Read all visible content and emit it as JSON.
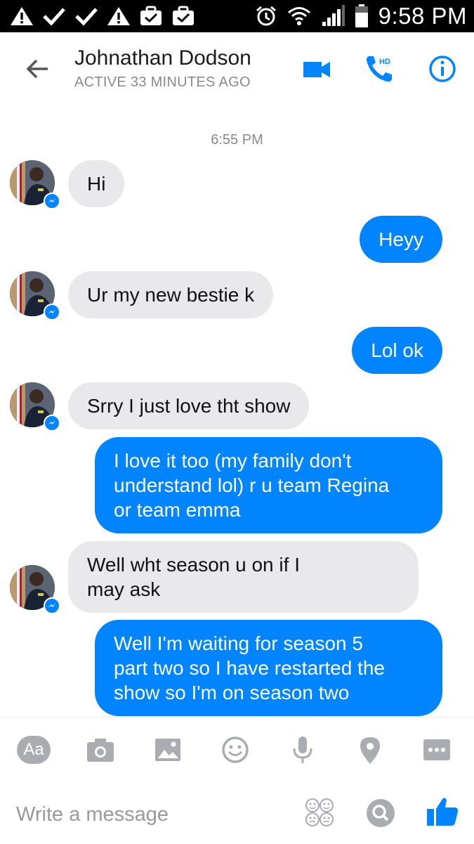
{
  "status_bar": {
    "left_icons": [
      "warning-icon",
      "check-icon",
      "check-icon",
      "warning-icon",
      "briefcase-check-icon",
      "briefcase-check-icon"
    ],
    "right_icons": [
      "alarm-icon",
      "wifi-icon",
      "signal-icon",
      "battery-icon"
    ],
    "time": "9:58 PM"
  },
  "header": {
    "contact_name": "Johnathan Dodson",
    "status": "ACTIVE 33 MINUTES AGO",
    "icons": [
      "back-arrow-icon",
      "video-camera-icon",
      "phone-hd-icon",
      "info-icon"
    ],
    "accent_color": "#0084ff"
  },
  "conversation": {
    "timestamp": "6:55 PM",
    "messages": [
      {
        "from": "them",
        "text": "Hi"
      },
      {
        "from": "me",
        "text": "Heyy"
      },
      {
        "from": "them",
        "text": "Ur my new bestie k"
      },
      {
        "from": "me",
        "text": "Lol ok"
      },
      {
        "from": "them",
        "text": "Srry I just love tht show"
      },
      {
        "from": "me",
        "text": "I love it too (my family don't\nunderstand lol)  r u team Regina\nor team emma"
      },
      {
        "from": "them",
        "text": "Well wht season u on if I\nmay ask"
      },
      {
        "from": "me",
        "text": "Well I'm waiting for season 5\npart two so I have restarted the\nshow so I'm on season two"
      }
    ],
    "incoming_bubble_color": "#e9e9eb",
    "outgoing_bubble_color": "#0084ff"
  },
  "composer": {
    "text_button": "Aa",
    "tools": [
      "camera-icon",
      "image-icon",
      "emoji-icon",
      "microphone-icon",
      "location-pin-icon",
      "more-icon"
    ],
    "placeholder": "Write a message",
    "right_icons": [
      "stickers-icon",
      "search-icon",
      "thumbs-up-icon"
    ]
  }
}
